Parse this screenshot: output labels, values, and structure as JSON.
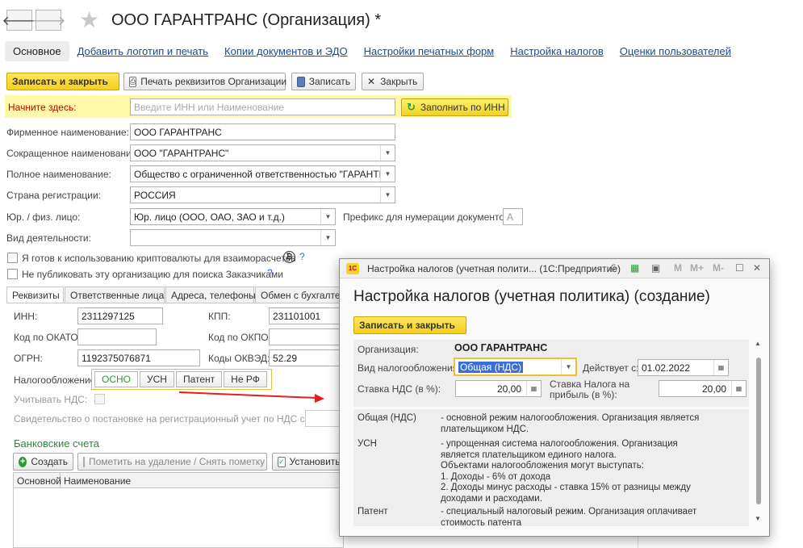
{
  "header": {
    "back_icon": "arrow-left-icon",
    "forward_icon": "arrow-right-icon",
    "title": "ООО ГАРАНТРАНС (Организация) *"
  },
  "tabs": [
    {
      "label": "Основное",
      "active": true
    },
    {
      "label": "Добавить логотип и печать"
    },
    {
      "label": "Копии документов и ЭДО"
    },
    {
      "label": "Настройки печатных форм"
    },
    {
      "label": "Настройка налогов"
    },
    {
      "label": "Оценки пользователей"
    }
  ],
  "toolbar": {
    "save_close": "Записать и закрыть",
    "print_details": "Печать реквизитов Организации",
    "save": "Записать",
    "close": "Закрыть"
  },
  "start": {
    "label": "Начните здесь:",
    "placeholder": "Введите ИНН или Наименование",
    "fill_button": "Заполнить по ИНН"
  },
  "form": {
    "firm_name_label": "Фирменное наименование:",
    "firm_name_value": "ООО ГАРАНТРАНС",
    "short_name_label": "Сокращенное наименование:",
    "short_name_value": "ООО \"ГАРАНТРАНС\"",
    "full_name_label": "Полное наименование:",
    "full_name_value": "Общество с ограниченной ответственностью \"ГАРАНТРАНС\"",
    "country_label": "Страна регистрации:",
    "country_value": "РОССИЯ",
    "legal_type_label": "Юр. / физ. лицо:",
    "legal_type_value": "Юр. лицо (ООО, ОАО, ЗАО и т.д.)",
    "prefix_label": "Префикс для нумерации документов :",
    "prefix_value": "А",
    "activity_label": "Вид деятельности:",
    "activity_value": "",
    "crypto_label": "Я готов к использованию криптовалюты для взаиморасчетов",
    "no_publish_label": "Не публиковать эту организацию для поиска Заказчиками",
    "help": "?"
  },
  "subtabs": [
    {
      "label": "Реквизиты",
      "active": true
    },
    {
      "label": "Ответственные лица"
    },
    {
      "label": "Адреса, телефоны"
    },
    {
      "label": "Обмен с бухгалтер"
    }
  ],
  "requisites": {
    "inn_label": "ИНН:",
    "inn_value": "2311297125",
    "kpp_label": "КПП:",
    "kpp_value": "231101001",
    "okato_label": "Код по ОКАТО:",
    "okato_value": "",
    "okpo_label": "Код по ОКПО:",
    "okpo_value": "",
    "ogrn_label": "ОГРН:",
    "ogrn_value": "1192375076871",
    "okved_label": "Коды ОКВЭД:",
    "okved_value": "52.29",
    "tax_label": "Налогообложение:",
    "tax_options": [
      "ОСНО",
      "УСН",
      "Патент",
      "Не РФ"
    ],
    "tax_selected": "ОСНО",
    "vat_label": "Учитывать НДС:",
    "certificate_label": "Свидетельство о постановке на регистрационный учет по НДС серия:"
  },
  "bank": {
    "title": "Банковские счета",
    "create": "Создать",
    "mark_delete": "Пометить на удаление / Снять пометку",
    "set_default": "Установить",
    "col_main": "Основной",
    "col_name": "Наименование"
  },
  "dialog": {
    "window_title": "Настройка налогов (учетная полити... (1С:Предприятие)",
    "heading": "Настройка налогов (учетная политика) (создание)",
    "save_close": "Записать и закрыть",
    "org_label": "Организация:",
    "org_value": "ООО ГАРАНТРАНС",
    "tax_type_label": "Вид налогообложения:",
    "tax_type_value": "Общая (НДС)",
    "valid_from_label": "Действует с:",
    "valid_from_value": "01.02.2022",
    "vat_rate_label": "Ставка НДС (в %):",
    "vat_rate_value": "20,00",
    "profit_rate_label": "Ставка Налога на прибыль (в %):",
    "profit_rate_value": "20,00",
    "tb_icons": [
      "M",
      "M+",
      "M-"
    ],
    "descriptions": [
      {
        "key": "Общая (НДС)",
        "text": "- основной режим налогообложения. Организация является\nплательщиком НДС."
      },
      {
        "key": "УСН",
        "text": "- упрощенная система налогообложения. Организация\nявляется плательщиком единого налога.\nОбъектами налогообложения могут выступать:\n1. Доходы - 6% от дохода\n2. Доходы минус расходы - ставка 15% от разницы между\nдоходами и расходами."
      },
      {
        "key": "Патент",
        "text": "- специальный налоговый режим. Организация оплачивает\nстоимость патента"
      }
    ]
  },
  "colors": {
    "accent_yellow": "#f5cf1a",
    "link_blue": "#1c4b94",
    "arrow_red": "#e02020",
    "section_green": "#2a8a3a"
  }
}
